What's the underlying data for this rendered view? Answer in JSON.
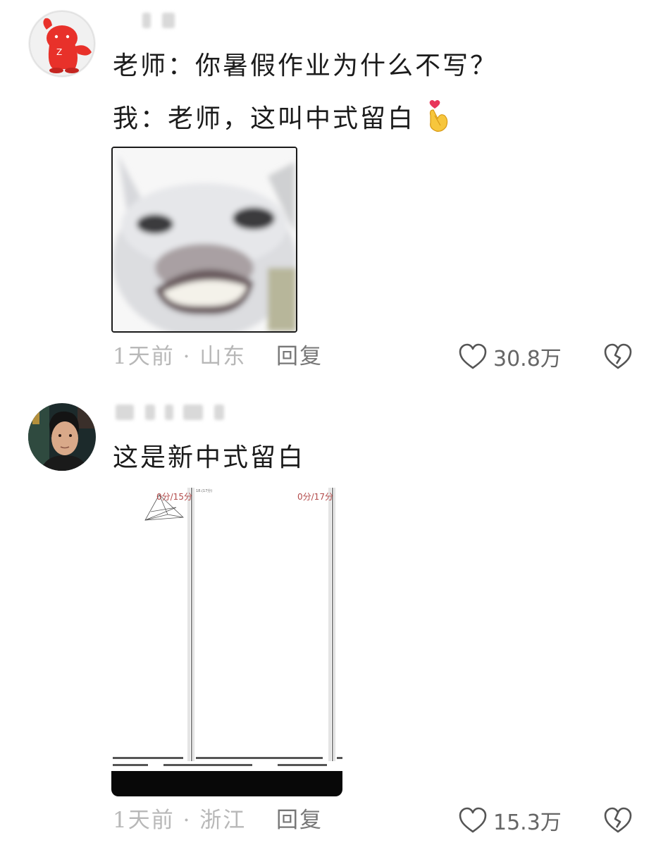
{
  "comments": [
    {
      "avatar": "red-bear-avatar",
      "lines": [
        "老师：你暑假作业为什么不写？",
        "我：老师，这叫中式留白"
      ],
      "emoji": "finger-heart-emoji",
      "image": "smiling-cat-image",
      "time_location": "1天前 · 山东",
      "reply_label": "回复",
      "likes": "30.8万"
    },
    {
      "avatar": "man-portrait-avatar",
      "lines": [
        "这是新中式留白"
      ],
      "image": "blank-exam-paper-image",
      "image_scores": [
        "0分/15分",
        "0分/17分"
      ],
      "time_location": "1天前 · 浙江",
      "reply_label": "回复",
      "likes": "15.3万"
    }
  ],
  "colors": {
    "text": "#1b1b1b",
    "meta": "#b8b8b8",
    "reply": "#777777",
    "score_red": "#b24a4a",
    "avatar_red": "#e8312a"
  },
  "icons": [
    "heart-outline-icon",
    "broken-heart-icon"
  ]
}
